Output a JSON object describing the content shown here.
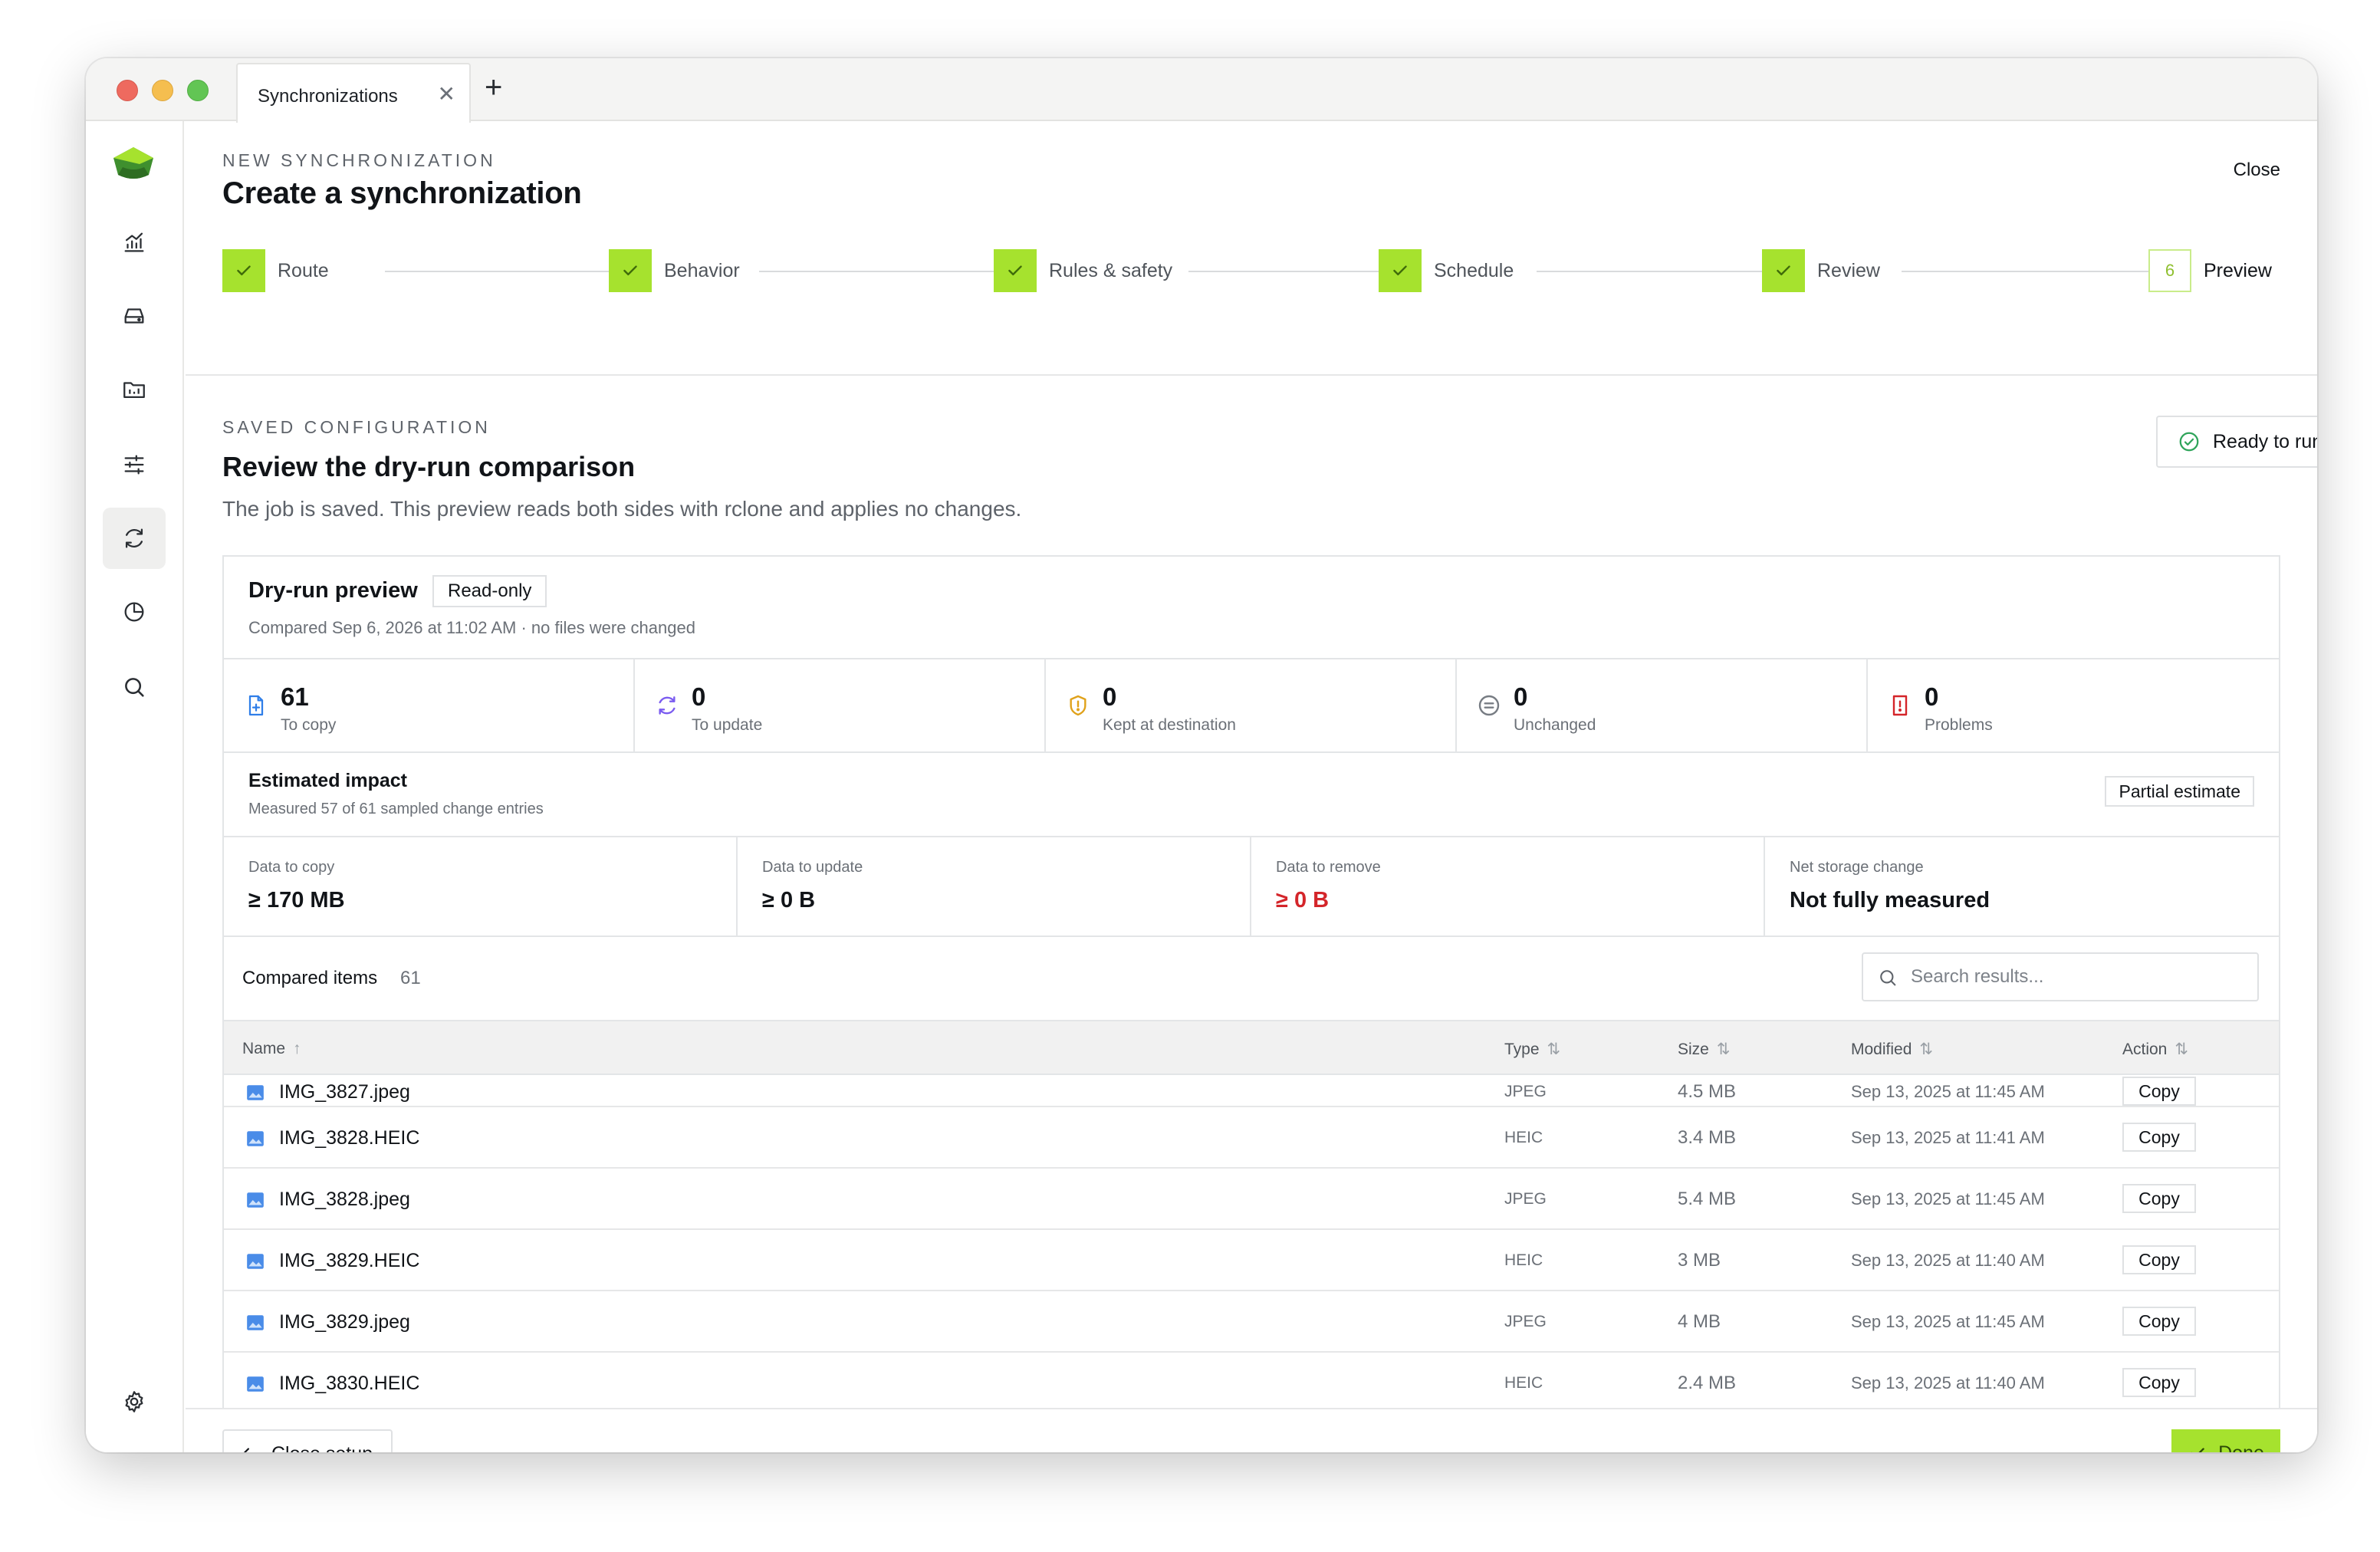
{
  "window": {
    "tab_title": "Synchronizations",
    "tab_close_icon": "close-icon",
    "new_tab_icon": "plus-icon"
  },
  "sidebar": {
    "items": [
      {
        "icon": "analytics-icon",
        "active": false
      },
      {
        "icon": "drive-icon",
        "active": false
      },
      {
        "icon": "folder-icon",
        "active": false
      },
      {
        "icon": "sliders-icon",
        "active": false
      },
      {
        "icon": "sync-icon",
        "active": true
      },
      {
        "icon": "pie-chart-icon",
        "active": false
      },
      {
        "icon": "search-icon",
        "active": false
      }
    ],
    "settings_icon": "gear-icon"
  },
  "header": {
    "eyebrow": "NEW SYNCHRONIZATION",
    "title": "Create a synchronization",
    "close_label": "Close"
  },
  "stepper": {
    "steps": [
      {
        "label": "Route",
        "state": "done"
      },
      {
        "label": "Behavior",
        "state": "done"
      },
      {
        "label": "Rules & safety",
        "state": "done"
      },
      {
        "label": "Schedule",
        "state": "done"
      },
      {
        "label": "Review",
        "state": "done"
      },
      {
        "label": "Preview",
        "state": "current",
        "number": "6"
      }
    ]
  },
  "section": {
    "eyebrow": "SAVED CONFIGURATION",
    "title": "Review the dry-run comparison",
    "description": "The job is saved. This preview reads both sides with rclone and applies no changes.",
    "status_label": "Ready to run"
  },
  "preview": {
    "title": "Dry-run preview",
    "badge": "Read-only",
    "subtitle": "Compared Sep 6, 2026 at 11:02 AM · no files were changed",
    "stats": [
      {
        "value": "61",
        "label": "To copy",
        "icon": "file-plus-icon",
        "color": "#2f7ee8"
      },
      {
        "value": "0",
        "label": "To update",
        "icon": "refresh-icon",
        "color": "#7b5cf0"
      },
      {
        "value": "0",
        "label": "Kept at destination",
        "icon": "shield-icon",
        "color": "#e0a21b"
      },
      {
        "value": "0",
        "label": "Unchanged",
        "icon": "equal-circle-icon",
        "color": "#777c83"
      },
      {
        "value": "0",
        "label": "Problems",
        "icon": "alert-file-icon",
        "color": "#d4252a"
      }
    ],
    "impact": {
      "title": "Estimated impact",
      "subtitle": "Measured 57 of 61 sampled change entries",
      "badge": "Partial estimate"
    },
    "metrics": [
      {
        "label": "Data to copy",
        "value": "≥ 170 MB",
        "tone": "normal"
      },
      {
        "label": "Data to update",
        "value": "≥ 0 B",
        "tone": "normal"
      },
      {
        "label": "Data to remove",
        "value": "≥ 0 B",
        "tone": "danger"
      },
      {
        "label": "Net storage change",
        "value": "Not fully measured",
        "tone": "normal"
      }
    ]
  },
  "compared": {
    "title": "Compared items",
    "count": "61",
    "search_placeholder": "Search results...",
    "columns": {
      "name": "Name",
      "type": "Type",
      "size": "Size",
      "modified": "Modified",
      "action": "Action"
    },
    "rows": [
      {
        "name": "IMG_3827.jpeg",
        "type": "JPEG",
        "size": "4.5 MB",
        "modified": "Sep 13, 2025 at 11:45 AM",
        "action": "Copy"
      },
      {
        "name": "IMG_3828.HEIC",
        "type": "HEIC",
        "size": "3.4 MB",
        "modified": "Sep 13, 2025 at 11:41 AM",
        "action": "Copy"
      },
      {
        "name": "IMG_3828.jpeg",
        "type": "JPEG",
        "size": "5.4 MB",
        "modified": "Sep 13, 2025 at 11:45 AM",
        "action": "Copy"
      },
      {
        "name": "IMG_3829.HEIC",
        "type": "HEIC",
        "size": "3 MB",
        "modified": "Sep 13, 2025 at 11:40 AM",
        "action": "Copy"
      },
      {
        "name": "IMG_3829.jpeg",
        "type": "JPEG",
        "size": "4 MB",
        "modified": "Sep 13, 2025 at 11:45 AM",
        "action": "Copy"
      },
      {
        "name": "IMG_3830.HEIC",
        "type": "HEIC",
        "size": "2.4 MB",
        "modified": "Sep 13, 2025 at 11:40 AM",
        "action": "Copy"
      }
    ]
  },
  "footer": {
    "close_setup_label": "Close setup",
    "done_label": "Done"
  },
  "colors": {
    "accent": "#a6e22e",
    "danger": "#d4252a"
  }
}
